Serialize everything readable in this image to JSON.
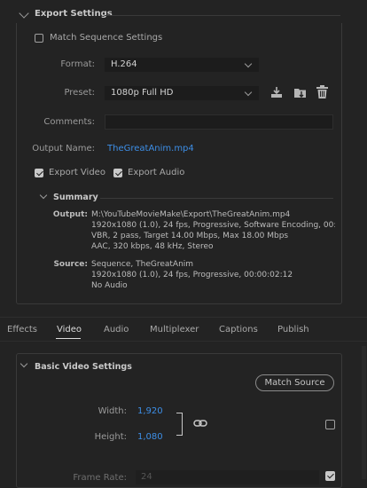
{
  "export_settings": {
    "title": "Export Settings",
    "match_sequence_label": "Match Sequence Settings",
    "format_label": "Format:",
    "format_value": "H.264",
    "preset_label": "Preset:",
    "preset_value": "1080p Full HD",
    "comments_label": "Comments:",
    "comments_value": "",
    "output_name_label": "Output Name:",
    "output_name_value": "TheGreatAnim.mp4",
    "export_video_label": "Export Video",
    "export_audio_label": "Export Audio",
    "export_video_checked": true,
    "export_audio_checked": true,
    "match_sequence_checked": false
  },
  "summary": {
    "title": "Summary",
    "output_label": "Output:",
    "output_lines": [
      "M:\\YouTubeMovieMake\\Export\\TheGreatAnim.mp4",
      "1920x1080 (1.0), 24 fps, Progressive, Software Encoding, 00:...",
      "VBR, 2 pass, Target 14.00 Mbps, Max 18.00 Mbps",
      "AAC, 320 kbps, 48 kHz, Stereo"
    ],
    "source_label": "Source:",
    "source_lines": [
      "Sequence, TheGreatAnim",
      "1920x1080 (1.0), 24 fps, Progressive, 00:00:02:12",
      "No Audio"
    ]
  },
  "tabs": [
    "Effects",
    "Video",
    "Audio",
    "Multiplexer",
    "Captions",
    "Publish"
  ],
  "active_tab": "Video",
  "basic_video": {
    "title": "Basic Video Settings",
    "match_source_label": "Match Source",
    "width_label": "Width:",
    "width_value": "1,920",
    "height_label": "Height:",
    "height_value": "1,080",
    "frame_rate_label": "Frame Rate:",
    "frame_rate_value": "24"
  },
  "colors": {
    "accent": "#3d8ee6",
    "background": "#232323",
    "field": "#1c1c1c"
  },
  "icons": [
    "chevron-down-icon",
    "save-preset-icon",
    "import-preset-icon",
    "trash-icon",
    "link-icon"
  ]
}
